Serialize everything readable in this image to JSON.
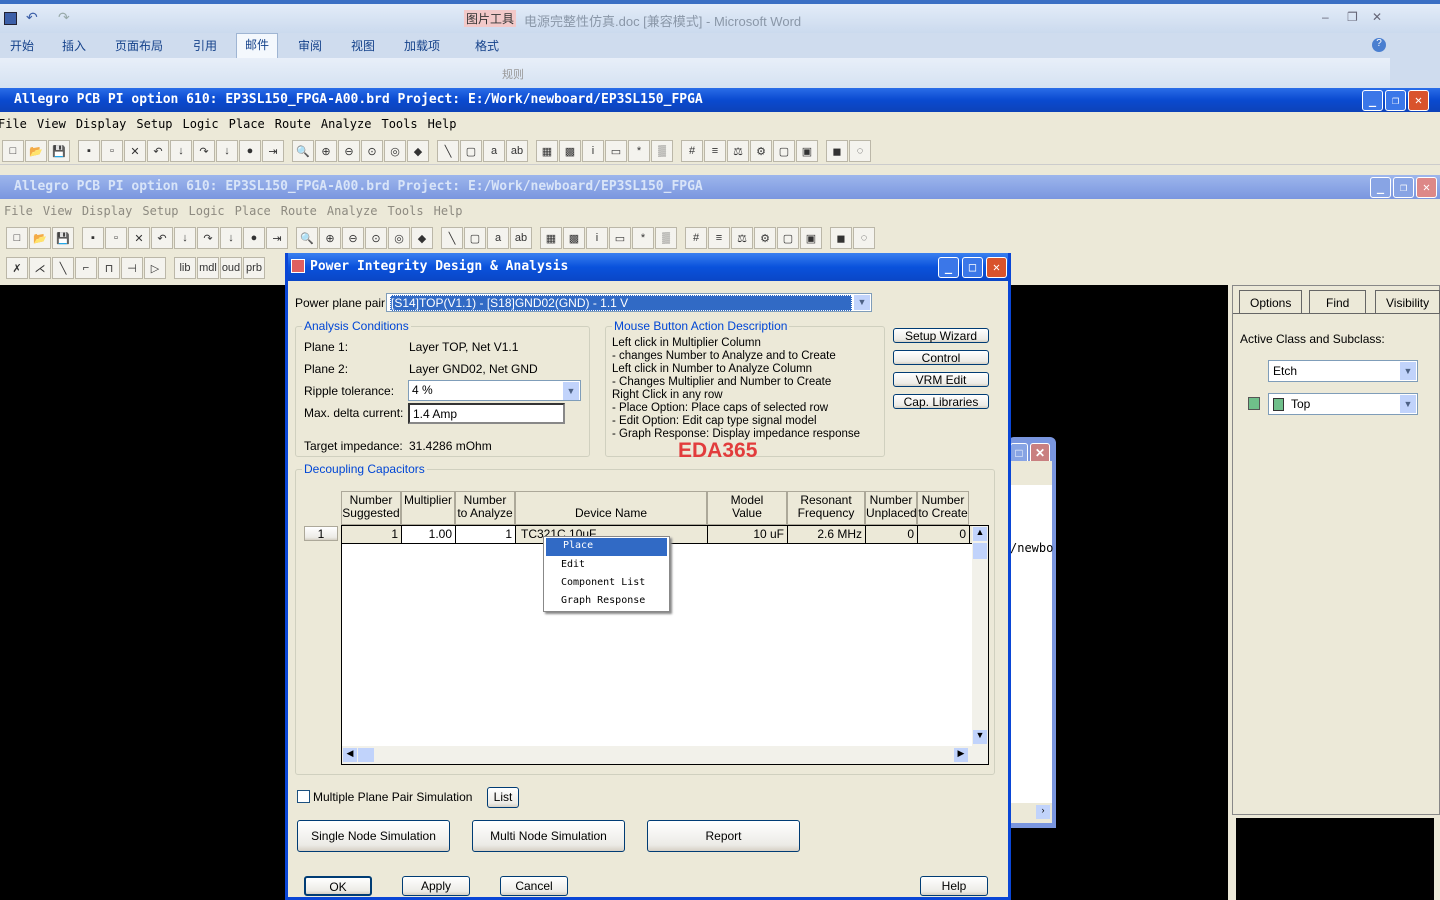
{
  "word": {
    "tool_context": "图片工具",
    "title": "电源完整性仿真.doc [兼容模式] - Microsoft Word",
    "tabs": [
      "开始",
      "插入",
      "页面布局",
      "引用",
      "邮件",
      "审阅",
      "视图",
      "加载项",
      "格式"
    ],
    "active_tab": "邮件",
    "rules_label": "规则"
  },
  "allegro1": {
    "title": "Allegro PCB PI option 610: EP3SL150_FPGA-A00.brd  Project: E:/Work/newboard/EP3SL150_FPGA",
    "menu": [
      "File",
      "View",
      "Display",
      "Setup",
      "Logic",
      "Place",
      "Route",
      "Analyze",
      "Tools",
      "Help"
    ]
  },
  "allegro2": {
    "title": "Allegro PCB PI option 610: EP3SL150_FPGA-A00.brd  Project: E:/Work/newboard/EP3SL150_FPGA",
    "menu": [
      "File",
      "View",
      "Display",
      "Setup",
      "Logic",
      "Place",
      "Route",
      "Analyze",
      "Tools",
      "Help"
    ]
  },
  "behind_window": {
    "text": "/newbo"
  },
  "dialog": {
    "title": "Power Integrity Design & Analysis",
    "power_plane_pair_label": "Power plane pair:",
    "power_plane_pair_value": "[S14]TOP(V1.1) - [S18]GND02(GND) - 1.1 V",
    "analysis": {
      "title": "Analysis Conditions",
      "plane1_label": "Plane 1:",
      "plane1_value": "Layer TOP, Net V1.1",
      "plane2_label": "Plane 2:",
      "plane2_value": "Layer GND02, Net GND",
      "ripple_label": "Ripple tolerance:",
      "ripple_value": "4 %",
      "delta_label": "Max. delta current:",
      "delta_value": "1.4 Amp",
      "target_label": "Target impedance:",
      "target_value": "31.4286 mOhm"
    },
    "mouse": {
      "title": "Mouse Button Action Description",
      "lines": [
        "Left click in Multiplier Column",
        "- changes Number to Analyze and to Create",
        "Left click in Number to Analyze Column",
        "- Changes Multiplier and Number to Create",
        "Right Click in any row",
        "- Place Option: Place caps of selected row",
        "- Edit Option: Edit cap type signal model",
        "- Graph Response: Display impedance response"
      ]
    },
    "watermark": "EDA365",
    "side_buttons": [
      "Setup Wizard",
      "Control",
      "VRM Edit",
      "Cap. Libraries"
    ],
    "decap": {
      "title": "Decoupling Capacitors",
      "headers": [
        "Number\nSuggested",
        "Multiplier",
        "Number\nto Analyze",
        "Device Name",
        "Model\nValue",
        "Resonant\nFrequency",
        "Number\nUnplaced",
        "Number\nto Create"
      ],
      "rows": [
        {
          "index": "1",
          "cells": [
            "1",
            "1.00",
            "1",
            "TC321C.10uF",
            "10 uF",
            "2.6 MHz",
            "0",
            "0"
          ]
        }
      ]
    },
    "context_menu": [
      "Place",
      "Edit",
      "Component List",
      "Graph Response"
    ],
    "multi_plane_label": "Multiple Plane Pair Simulation",
    "multi_plane_checked": false,
    "list_button": "List",
    "sim_buttons": [
      "Single Node Simulation",
      "Multi Node Simulation",
      "Report"
    ],
    "bottom_buttons": [
      "OK",
      "Apply",
      "Cancel",
      "Help"
    ]
  },
  "panel": {
    "tabs": [
      "Options",
      "Find",
      "Visibility"
    ],
    "active_class_label": "Active Class and Subclass:",
    "class_value": "Etch",
    "subclass_value": "Top",
    "subclass_color": "#6fbf8a"
  }
}
